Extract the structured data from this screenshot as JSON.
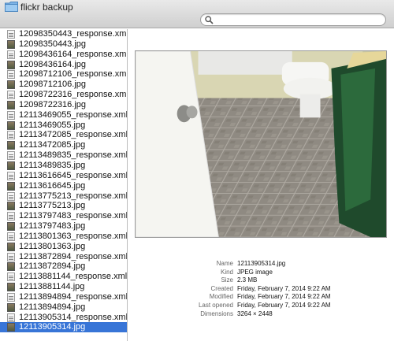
{
  "window": {
    "title": "flickr backup"
  },
  "search": {
    "placeholder": "",
    "value": ""
  },
  "files": [
    {
      "name": "12098350443_response.xml",
      "type": "xml"
    },
    {
      "name": "12098350443.jpg",
      "type": "jpg"
    },
    {
      "name": "12098436164_response.xml",
      "type": "xml"
    },
    {
      "name": "12098436164.jpg",
      "type": "jpg"
    },
    {
      "name": "12098712106_response.xml",
      "type": "xml"
    },
    {
      "name": "12098712106.jpg",
      "type": "jpg"
    },
    {
      "name": "12098722316_response.xml",
      "type": "xml"
    },
    {
      "name": "12098722316.jpg",
      "type": "jpg"
    },
    {
      "name": "12113469055_response.xml",
      "type": "xml"
    },
    {
      "name": "12113469055.jpg",
      "type": "jpg"
    },
    {
      "name": "12113472085_response.xml",
      "type": "xml"
    },
    {
      "name": "12113472085.jpg",
      "type": "jpg"
    },
    {
      "name": "12113489835_response.xml",
      "type": "xml"
    },
    {
      "name": "12113489835.jpg",
      "type": "jpg"
    },
    {
      "name": "12113616645_response.xml",
      "type": "xml"
    },
    {
      "name": "12113616645.jpg",
      "type": "jpg"
    },
    {
      "name": "12113775213_response.xml",
      "type": "xml"
    },
    {
      "name": "12113775213.jpg",
      "type": "jpg"
    },
    {
      "name": "12113797483_response.xml",
      "type": "xml"
    },
    {
      "name": "12113797483.jpg",
      "type": "jpg"
    },
    {
      "name": "12113801363_response.xml",
      "type": "xml"
    },
    {
      "name": "12113801363.jpg",
      "type": "jpg"
    },
    {
      "name": "12113872894_response.xml",
      "type": "xml"
    },
    {
      "name": "12113872894.jpg",
      "type": "jpg"
    },
    {
      "name": "12113881144_response.xml",
      "type": "xml"
    },
    {
      "name": "12113881144.jpg",
      "type": "jpg"
    },
    {
      "name": "12113894894_response.xml",
      "type": "xml"
    },
    {
      "name": "12113894894.jpg",
      "type": "jpg"
    },
    {
      "name": "12113905314_response.xml",
      "type": "xml"
    },
    {
      "name": "12113905314.jpg",
      "type": "jpg",
      "selected": true
    }
  ],
  "info": [
    {
      "label": "Name",
      "value": "12113905314.jpg"
    },
    {
      "label": "Kind",
      "value": "JPEG image"
    },
    {
      "label": "Size",
      "value": "2.3 MB"
    },
    {
      "label": "Created",
      "value": "Friday, February 7, 2014 9:22 AM"
    },
    {
      "label": "Modified",
      "value": "Friday, February 7, 2014 9:22 AM"
    },
    {
      "label": "Last opened",
      "value": "Friday, February 7, 2014 9:22 AM"
    },
    {
      "label": "Dimensions",
      "value": "3264 × 2448"
    }
  ],
  "colors": {
    "selection": "#3875d7",
    "titlebar": "#dcdcdc"
  },
  "icons": {
    "folder": "folder-icon",
    "search": "search-icon"
  }
}
